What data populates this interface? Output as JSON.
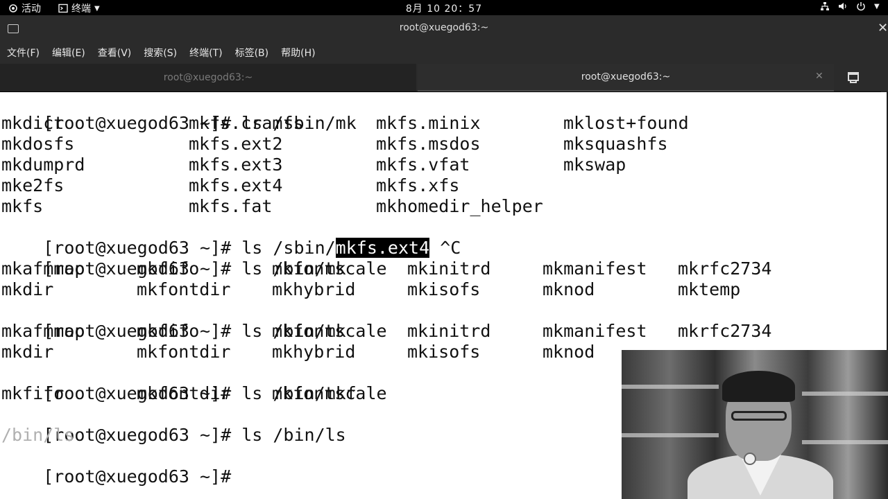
{
  "topbar": {
    "activities": "活动",
    "app_menu": "终端",
    "clock": "8月 10  20：57"
  },
  "window": {
    "title": "root@xuegod63:~"
  },
  "menubar": {
    "items": [
      "文件(F)",
      "编辑(E)",
      "查看(V)",
      "搜索(S)",
      "终端(T)",
      "标签(B)",
      "帮助(H)"
    ]
  },
  "tabs": [
    {
      "label": "root@xuegod63:~",
      "active": false
    },
    {
      "label": "root@xuegod63:~",
      "active": true
    }
  ],
  "terminal": {
    "lines": [
      {
        "type": "cmd",
        "prompt": "[root@xuegod63 ~]#",
        "command": " ls /sbin/mk"
      },
      {
        "type": "cols",
        "cells": [
          "mkdict",
          "mkfs.cramfs",
          "mkfs.minix",
          "mklost+found"
        ]
      },
      {
        "type": "cols",
        "cells": [
          "mkdosfs",
          "mkfs.ext2",
          "mkfs.msdos",
          "mksquashfs"
        ]
      },
      {
        "type": "cols",
        "cells": [
          "mkdumprd",
          "mkfs.ext3",
          "mkfs.vfat",
          "mkswap"
        ]
      },
      {
        "type": "cols",
        "cells": [
          "mke2fs",
          "mkfs.ext4",
          "mkfs.xfs",
          ""
        ]
      },
      {
        "type": "cols",
        "cells": [
          "mkfs",
          "mkfs.fat",
          "mkhomedir_helper",
          ""
        ]
      },
      {
        "type": "cmd_hl",
        "prompt": "[root@xuegod63 ~]#",
        "command": " ls /sbin/",
        "highlight": "mkfs.ext4",
        "after": " ^C"
      },
      {
        "type": "cmd",
        "prompt": "[root@xuegod63 ~]#",
        "command": " ls /bin/mk"
      },
      {
        "type": "cols6",
        "cells": [
          "mkafmmap",
          "mkfifo",
          "mkfontscale",
          "mkinitrd",
          "mkmanifest",
          "mkrfc2734"
        ]
      },
      {
        "type": "cols6",
        "cells": [
          "mkdir",
          "mkfontdir",
          "mkhybrid",
          "mkisofs",
          "mknod",
          "mktemp"
        ]
      },
      {
        "type": "cmd",
        "prompt": "[root@xuegod63 ~]#",
        "command": " ls /bin/mk"
      },
      {
        "type": "cols6",
        "cells": [
          "mkafmmap",
          "mkfifo",
          "mkfontscale",
          "mkinitrd",
          "mkmanifest",
          "mkrfc2734"
        ]
      },
      {
        "type": "cols6",
        "cells": [
          "mkdir",
          "mkfontdir",
          "mkhybrid",
          "mkisofs",
          "mknod",
          ""
        ]
      },
      {
        "type": "cmd",
        "prompt": "[root@xuegod63 ~]#",
        "command": " ls /bin/mkf"
      },
      {
        "type": "cols6",
        "cells": [
          "mkfifo",
          "mkfontdir",
          "mkfontscale",
          "",
          "",
          ""
        ]
      },
      {
        "type": "cmd",
        "prompt": "[root@xuegod63 ~]#",
        "command": " ls /bin/ls"
      },
      {
        "type": "dim",
        "text": "/bin/ls"
      },
      {
        "type": "cmd",
        "prompt": "[root@xuegod63 ~]#",
        "command": ""
      }
    ]
  },
  "icons": {
    "terminal_app": "terminal-icon",
    "network": "network-icon",
    "volume": "volume-icon",
    "power": "power-icon",
    "new_window": "new-window-icon"
  }
}
